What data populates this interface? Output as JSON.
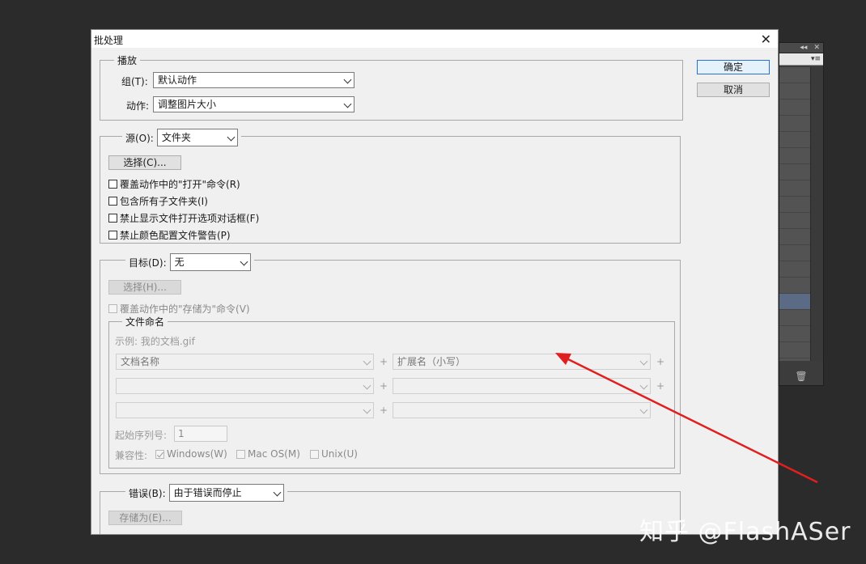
{
  "dialog": {
    "title": "批处理",
    "close_glyph": "✕",
    "ok_label": "确定",
    "cancel_label": "取消"
  },
  "play": {
    "legend": "播放",
    "group_label": "组(T):",
    "group_value": "默认动作",
    "action_label": "动作:",
    "action_value": "调整图片大小"
  },
  "source": {
    "legend": "源(O):",
    "value": "文件夹",
    "choose_label": "选择(C)...",
    "options": [
      "覆盖动作中的\"打开\"命令(R)",
      "包含所有子文件夹(I)",
      "禁止显示文件打开选项对话框(F)",
      "禁止颜色配置文件警告(P)"
    ]
  },
  "destination": {
    "legend": "目标(D):",
    "value": "无",
    "choose_label": "选择(H)...",
    "override_label": "覆盖动作中的\"存储为\"命令(V)",
    "naming": {
      "legend": "文件命名",
      "example": "示例: 我的文档.gif",
      "field1": "文档名称",
      "field2": "扩展名（小写）",
      "plus": "+",
      "serial_label": "起始序列号:",
      "serial_value": "1",
      "compat_label": "兼容性:",
      "compat_windows": "Windows(W)",
      "compat_mac": "Mac OS(M)",
      "compat_unix": "Unix(U)"
    }
  },
  "errors": {
    "legend": "错误(B):",
    "value": "由于错误而停止",
    "save_label": "存储为(E)..."
  },
  "watermark": "知乎 @FlashASer",
  "colors": {
    "arrow": "#e02020",
    "primary_border": "#2a6fd3"
  }
}
